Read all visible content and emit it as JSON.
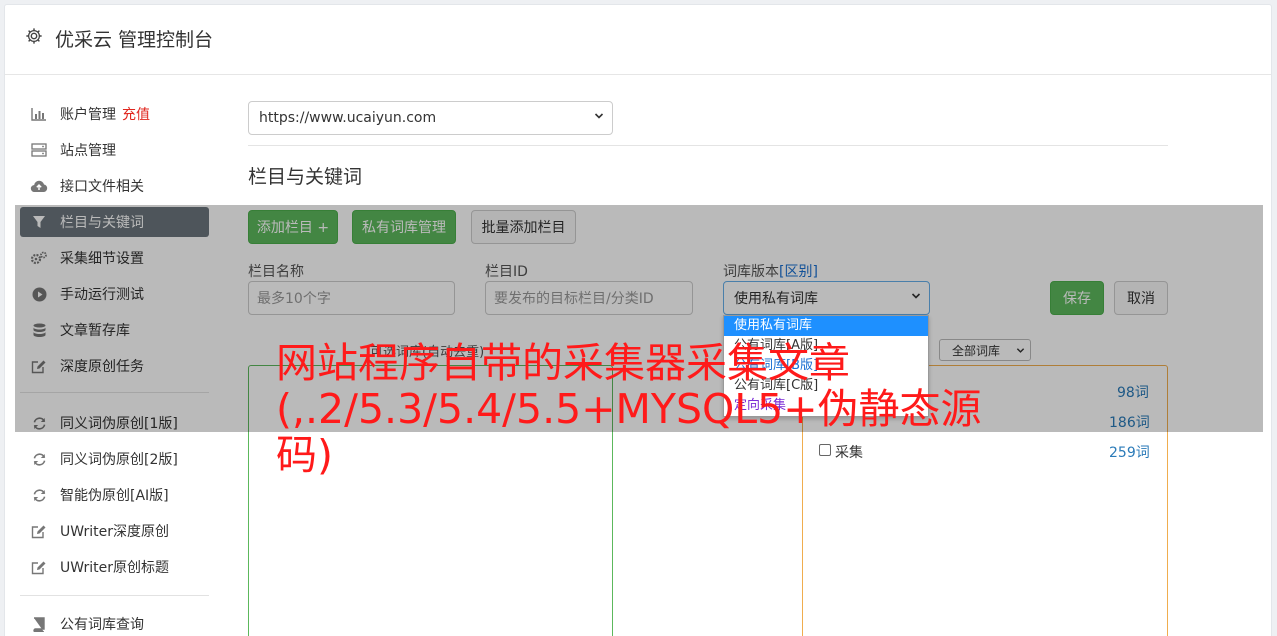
{
  "header": {
    "title": "优采云 管理控制台",
    "icon": "gear-icon"
  },
  "sidebar": {
    "items": [
      {
        "label": "账户管理",
        "badge": "充值",
        "icon": "bar-chart-icon"
      },
      {
        "label": "站点管理",
        "icon": "server-icon"
      },
      {
        "label": "接口文件相关",
        "icon": "cloud-upload-icon"
      },
      {
        "label": "栏目与关键词",
        "icon": "filter-icon",
        "active": true
      },
      {
        "label": "采集细节设置",
        "icon": "cogs-icon"
      },
      {
        "label": "手动运行测试",
        "icon": "play-circle-icon"
      },
      {
        "label": "文章暂存库",
        "icon": "database-icon"
      },
      {
        "label": "深度原创任务",
        "icon": "edit-icon"
      },
      {
        "label": "同义词伪原创[1版]",
        "icon": "refresh-icon"
      },
      {
        "label": "同义词伪原创[2版]",
        "icon": "refresh-icon"
      },
      {
        "label": "智能伪原创[AI版]",
        "icon": "refresh-icon"
      },
      {
        "label": "UWriter深度原创",
        "icon": "edit-icon"
      },
      {
        "label": "UWriter原创标题",
        "icon": "edit-icon"
      },
      {
        "label": "公有词库查询",
        "icon": "book-icon"
      }
    ],
    "badge_color": "#e0261e"
  },
  "main": {
    "site_select": {
      "value": "https://www.ucaiyun.com"
    },
    "section_title": "栏目与关键词",
    "buttons": {
      "add_column": "添加栏目 +",
      "private_lib": "私有词库管理",
      "batch_add": "批量添加栏目",
      "save": "保存",
      "cancel": "取消"
    },
    "fields": {
      "column_name_label": "栏目名称",
      "column_name_placeholder": "最多10个字",
      "column_id_label": "栏目ID",
      "column_id_placeholder": "要发布的目标栏目/分类ID",
      "lib_version_label": "词库版本",
      "lib_version_link": "[区别]",
      "lib_version_value": "使用私有词库"
    },
    "dropdown_options": [
      "使用私有词库",
      "公有词库[A版]",
      "公有词库[B版]",
      "公有词库[C版]",
      "定向采集"
    ],
    "optional_label": "可选词库(自动去重)",
    "filter_select": "全部词库",
    "right_items": [
      {
        "label": "",
        "count": "98词"
      },
      {
        "label": "",
        "count": "186词"
      },
      {
        "label": "采集",
        "count": "259词"
      }
    ]
  },
  "watermark": "网站程序自带的采集器采集文章(,.2/5.3/5.4/5.5+MYSQL5+伪静态源码)",
  "colors": {
    "green": "#5cb85c",
    "orange": "#f0ad4e",
    "active_nav": "#6c757d",
    "watermark": "#ff1a1a"
  }
}
